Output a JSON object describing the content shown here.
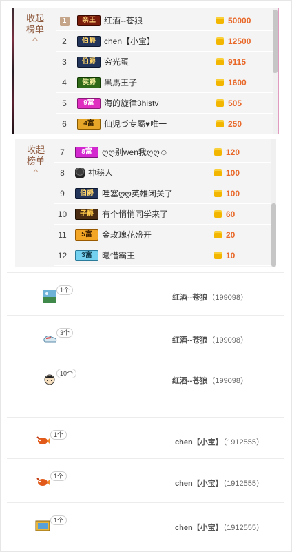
{
  "toggle_label": "收起榜单",
  "toggle_arrow": "^",
  "colors": {
    "amount": "#e8692a",
    "toggle": "#8f5a3e",
    "coin": "#f3b600"
  },
  "leaderboard_top": [
    {
      "rank": "1",
      "badge": "亲王",
      "badge_style": "king",
      "name": "红酒--苍狼",
      "amount": "50000"
    },
    {
      "rank": "2",
      "badge": "伯爵",
      "badge_style": "earl",
      "name": "chen【小宝】",
      "amount": "12500"
    },
    {
      "rank": "3",
      "badge": "伯爵",
      "badge_style": "earl",
      "name": "穷光蛋",
      "amount": "9115"
    },
    {
      "rank": "4",
      "badge": "侯爵",
      "badge_style": "duke",
      "name": "黑馬王子",
      "amount": "1600"
    },
    {
      "rank": "5",
      "badge": "9富",
      "badge_style": "pink",
      "name": "海的旋律3histv",
      "amount": "505"
    },
    {
      "rank": "6",
      "badge": "4富",
      "badge_style": "gold",
      "name": "仙児づ专屬♥唯一",
      "amount": "250"
    }
  ],
  "leaderboard_bottom": [
    {
      "rank": "7",
      "badge": "8富",
      "badge_style": "magenta",
      "name": "ღღ别wen我ღღ☺",
      "amount": "120"
    },
    {
      "rank": "8",
      "badge": "",
      "badge_style": "avatar",
      "name": "神秘人",
      "amount": "100"
    },
    {
      "rank": "9",
      "badge": "伯爵",
      "badge_style": "earl",
      "name": "哇塞ღღ英雄闭关了",
      "amount": "100"
    },
    {
      "rank": "10",
      "badge": "子爵",
      "badge_style": "count",
      "name": "有个悄悄同学来了",
      "amount": "60"
    },
    {
      "rank": "11",
      "badge": "5富",
      "badge_style": "orange",
      "name": "金玫瑰花盛开",
      "amount": "20"
    },
    {
      "rank": "12",
      "badge": "3富",
      "badge_style": "cyan",
      "name": "曦惜霸王",
      "amount": "10"
    }
  ],
  "gift_records": [
    {
      "gift_icon": "landscape-gift-icon",
      "count": "1个",
      "user": "红酒--苍狼",
      "uid": "199098"
    },
    {
      "gift_icon": "sneaker-gift-icon",
      "count": "3个",
      "user": "红酒--苍狼",
      "uid": "199098"
    },
    {
      "gift_icon": "cartoon-face-gift-icon",
      "count": "10个",
      "user": "红酒--苍狼",
      "uid": "199098"
    },
    {
      "gift_icon": "fish-gift-icon",
      "count": "1个",
      "user": "chen【小宝】",
      "uid": "1912555"
    },
    {
      "gift_icon": "fish-gift-icon",
      "count": "1个",
      "user": "chen【小宝】",
      "uid": "1912555"
    },
    {
      "gift_icon": "picture-frame-gift-icon",
      "count": "1个",
      "user": "chen【小宝】",
      "uid": "1912555"
    }
  ]
}
